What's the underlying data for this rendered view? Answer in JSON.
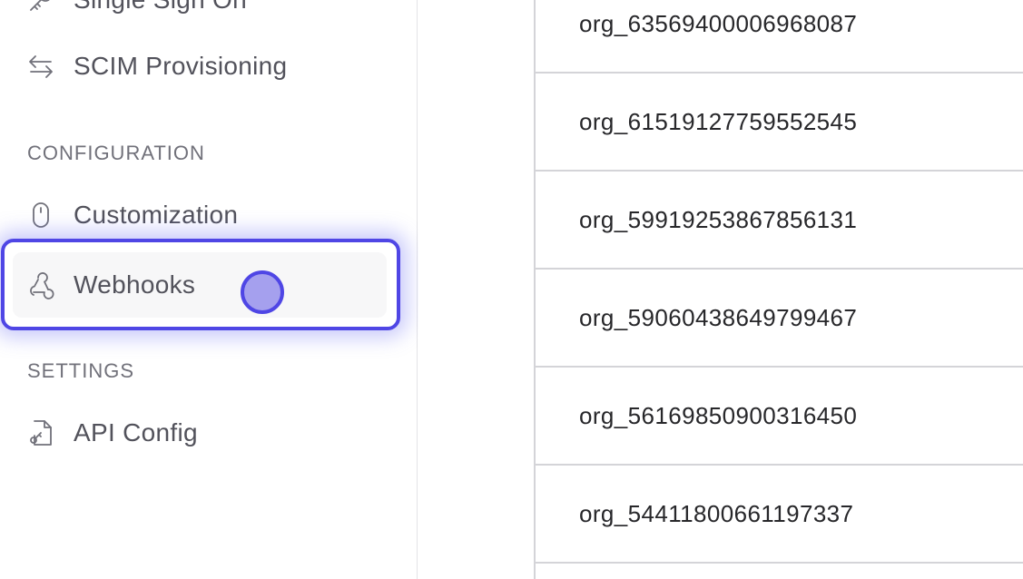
{
  "sidebar": {
    "items": [
      {
        "label": "Single Sign On",
        "icon": "key-icon"
      },
      {
        "label": "SCIM Provisioning",
        "icon": "arrows-exchange-icon"
      },
      {
        "label": "Customization",
        "icon": "mouse-icon"
      },
      {
        "label": "Webhooks",
        "icon": "webhook-icon"
      },
      {
        "label": "API Config",
        "icon": "file-key-icon"
      }
    ],
    "sections": {
      "configuration": "CONFIGURATION",
      "settings": "SETTINGS"
    }
  },
  "table": {
    "rows": [
      "org_63569400006968087",
      "org_61519127759552545",
      "org_59919253867856131",
      "org_59060438649799467",
      "org_56169850900316450",
      "org_54411800661197337"
    ]
  },
  "colors": {
    "accent": "#4f46e5",
    "selected_bg": "#f7f7f8",
    "text": "#52525b"
  }
}
